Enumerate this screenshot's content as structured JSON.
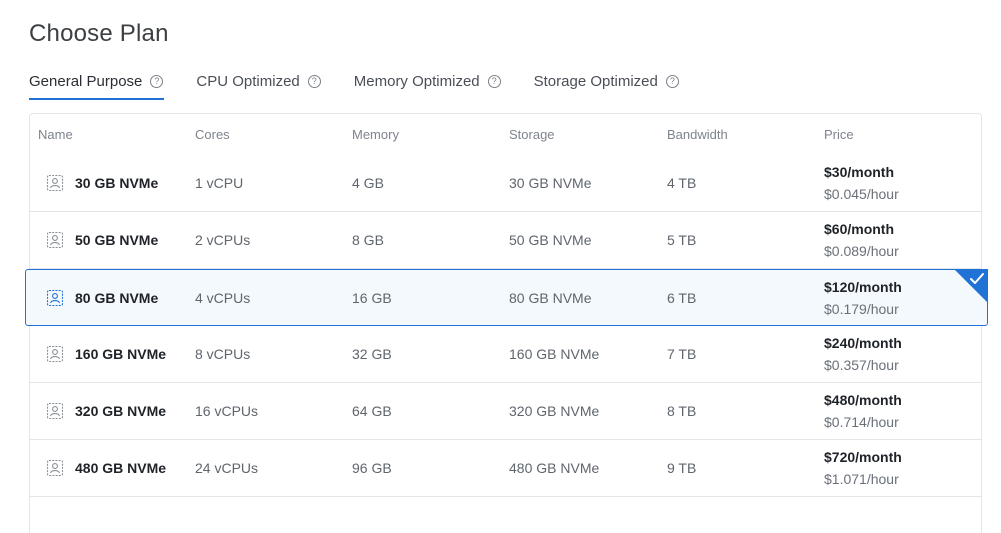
{
  "page": {
    "title": "Choose Plan"
  },
  "tabs": [
    {
      "label": "General Purpose",
      "active": true
    },
    {
      "label": "CPU Optimized",
      "active": false
    },
    {
      "label": "Memory Optimized",
      "active": false
    },
    {
      "label": "Storage Optimized",
      "active": false
    }
  ],
  "help_icon_glyph": "?",
  "table": {
    "headers": {
      "name": "Name",
      "cores": "Cores",
      "memory": "Memory",
      "storage": "Storage",
      "bandwidth": "Bandwidth",
      "price": "Price"
    },
    "rows": [
      {
        "name": "30 GB NVMe",
        "cores": "1 vCPU",
        "memory": "4 GB",
        "storage": "30 GB NVMe",
        "bandwidth": "4 TB",
        "price_month": "$30/month",
        "price_hour": "$0.045/hour",
        "selected": false
      },
      {
        "name": "50 GB NVMe",
        "cores": "2 vCPUs",
        "memory": "8 GB",
        "storage": "50 GB NVMe",
        "bandwidth": "5 TB",
        "price_month": "$60/month",
        "price_hour": "$0.089/hour",
        "selected": false
      },
      {
        "name": "80 GB NVMe",
        "cores": "4 vCPUs",
        "memory": "16 GB",
        "storage": "80 GB NVMe",
        "bandwidth": "6 TB",
        "price_month": "$120/month",
        "price_hour": "$0.179/hour",
        "selected": true
      },
      {
        "name": "160 GB NVMe",
        "cores": "8 vCPUs",
        "memory": "32 GB",
        "storage": "160 GB NVMe",
        "bandwidth": "7 TB",
        "price_month": "$240/month",
        "price_hour": "$0.357/hour",
        "selected": false
      },
      {
        "name": "320 GB NVMe",
        "cores": "16 vCPUs",
        "memory": "64 GB",
        "storage": "320 GB NVMe",
        "bandwidth": "8 TB",
        "price_month": "$480/month",
        "price_hour": "$0.714/hour",
        "selected": false
      },
      {
        "name": "480 GB NVMe",
        "cores": "24 vCPUs",
        "memory": "96 GB",
        "storage": "480 GB NVMe",
        "bandwidth": "9 TB",
        "price_month": "$720/month",
        "price_hour": "$1.071/hour",
        "selected": false
      }
    ]
  },
  "icons": {
    "plan": "plan-server-icon",
    "help": "help-circle-icon",
    "selected": "checkmark-icon"
  },
  "colors": {
    "accent": "#2073d4",
    "selected_bg": "#f4f9fe",
    "border": "#e2e5e9"
  }
}
